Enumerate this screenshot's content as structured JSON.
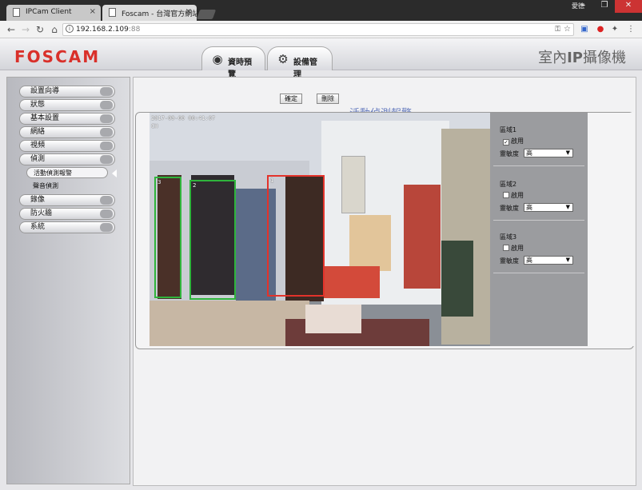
{
  "browser": {
    "tabs": [
      {
        "title": "IPCam Client",
        "close": "×"
      },
      {
        "title": "Foscam - 台灣官方網站",
        "close": "×"
      }
    ],
    "user": "愛德",
    "url_host": "192.168.2.109",
    "url_port": ":88"
  },
  "app": {
    "logo": "FOSCAM",
    "tab_live": "資時預覽",
    "tab_settings": "設備管理",
    "product_prefix": "室內",
    "product_bold": "IP",
    "product_suffix": "攝像機"
  },
  "sidebar": {
    "items": [
      {
        "label": "設置向導"
      },
      {
        "label": "狀態"
      },
      {
        "label": "基本設置"
      },
      {
        "label": "網絡"
      },
      {
        "label": "視頻"
      },
      {
        "label": "偵測"
      }
    ],
    "sub_items": [
      {
        "label": "活動偵測報警"
      },
      {
        "label": "聲音偵測"
      }
    ],
    "items_after": [
      {
        "label": "錄像"
      },
      {
        "label": "防火牆"
      },
      {
        "label": "系統"
      }
    ]
  },
  "content": {
    "confirm_label": "確定",
    "delete_label": "刪除",
    "title": "活動偵測報警",
    "osd_time": "2017-09-09 00:41:07",
    "osd_label": "CH",
    "zones": [
      {
        "id": "1",
        "color": "#e3332b"
      },
      {
        "id": "2",
        "color": "#2fb43c"
      },
      {
        "id": "3",
        "color": "#2fb43c"
      }
    ],
    "settings": [
      {
        "title": "區域1",
        "enable_label": "啟用",
        "checked": "✓",
        "sens_label": "靈敏度",
        "sens_value": "高"
      },
      {
        "title": "區域2",
        "enable_label": "啟用",
        "checked": "",
        "sens_label": "靈敏度",
        "sens_value": "高"
      },
      {
        "title": "區域3",
        "enable_label": "啟用",
        "checked": "",
        "sens_label": "靈敏度",
        "sens_value": "高"
      }
    ]
  }
}
